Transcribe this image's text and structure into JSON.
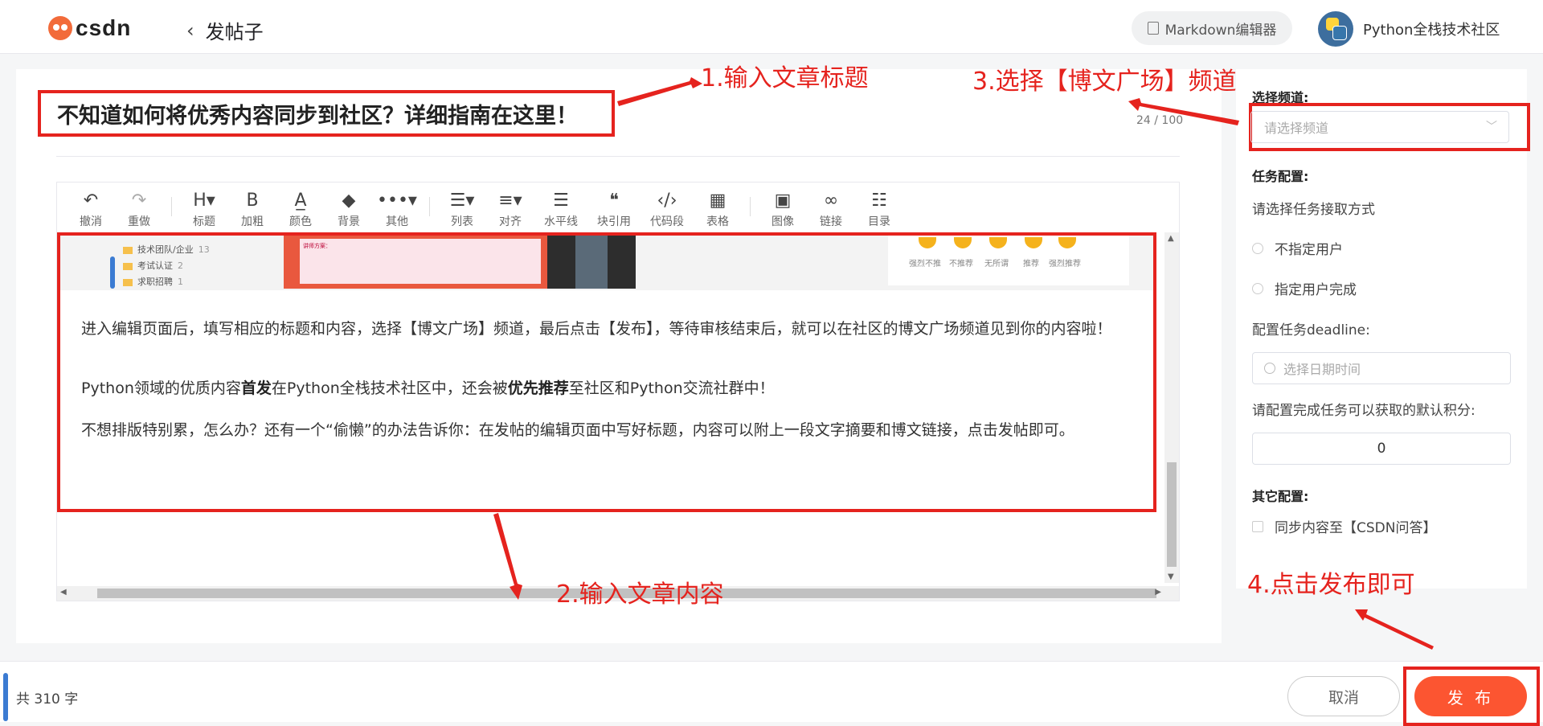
{
  "header": {
    "logo_text": "csdn",
    "back_label": "发帖子",
    "markdown_button": "Markdown编辑器",
    "community_name": "Python全栈技术社区"
  },
  "editor": {
    "title": "不知道如何将优秀内容同步到社区？详细指南在这里！",
    "title_counter": "24 / 100",
    "toolbar": [
      {
        "icon": "undo-icon",
        "glyph": "↶",
        "label": "撤消"
      },
      {
        "icon": "redo-icon",
        "glyph": "↷",
        "label": "重做"
      },
      {
        "icon": "heading-icon",
        "glyph": "H▾",
        "label": "标题"
      },
      {
        "icon": "bold-icon",
        "glyph": "B",
        "label": "加粗"
      },
      {
        "icon": "font-color-icon",
        "glyph": "A̲",
        "label": "颜色"
      },
      {
        "icon": "background-color-icon",
        "glyph": "◆",
        "label": "背景"
      },
      {
        "icon": "more-icon",
        "glyph": "•••▾",
        "label": "其他"
      },
      {
        "icon": "list-icon",
        "glyph": "☰▾",
        "label": "列表"
      },
      {
        "icon": "align-icon",
        "glyph": "≡▾",
        "label": "对齐"
      },
      {
        "icon": "horizontal-rule-icon",
        "glyph": "☰",
        "label": "水平线"
      },
      {
        "icon": "quote-icon",
        "glyph": "❝",
        "label": "块引用"
      },
      {
        "icon": "code-icon",
        "glyph": "‹/›",
        "label": "代码段"
      },
      {
        "icon": "table-icon",
        "glyph": "▦",
        "label": "表格"
      },
      {
        "icon": "image-icon",
        "glyph": "▣",
        "label": "图像"
      },
      {
        "icon": "link-icon",
        "glyph": "∞",
        "label": "链接"
      },
      {
        "icon": "toc-icon",
        "glyph": "☷",
        "label": "目录"
      }
    ],
    "tree_items": [
      {
        "label": "技术团队/企业",
        "count": "13"
      },
      {
        "label": "考试认证",
        "count": "2"
      },
      {
        "label": "求职招聘",
        "count": "1"
      }
    ],
    "poster_text": "讲师方案：",
    "emoji_labels": [
      "强烈不推",
      "不推荐",
      "无所谓",
      "推荐",
      "强烈推荐"
    ],
    "paragraph1": "进入编辑页面后，填写相应的标题和内容，选择【博文广场】频道，最后点击【发布】，等待审核结束后，就可以在社区的博文广场频道见到你的内容啦！",
    "paragraph2_a": "Python领域的优质内容",
    "paragraph2_b": "首发",
    "paragraph2_c": "在Python全栈技术社区中，还会被",
    "paragraph2_d": "优先推荐",
    "paragraph2_e": "至社区和Python交流社群中！",
    "paragraph3": "不想排版特别累，怎么办？还有一个“偷懒”的办法告诉你：在发帖的编辑页面中写好标题，内容可以附上一段文字摘要和博文链接，点击发帖即可。"
  },
  "sidebar": {
    "channel_label": "选择频道:",
    "channel_placeholder": "请选择频道",
    "task_label": "任务配置:",
    "task_prompt": "请选择任务接取方式",
    "radio_1": "不指定用户",
    "radio_2": "指定用户完成",
    "deadline_label": "配置任务deadline:",
    "deadline_placeholder": "选择日期时间",
    "points_label": "请配置完成任务可以获取的默认积分:",
    "points_value": "0",
    "other_label": "其它配置:",
    "sync_label": "同步内容至【CSDN问答】"
  },
  "footer": {
    "word_count": "共 310 字",
    "cancel": "取消",
    "publish": "发 布"
  },
  "annotations": {
    "step1": "1.输入文章标题",
    "step2": "2.输入文章内容",
    "step3": "3.选择【博文广场】频道",
    "step4": "4.点击发布即可"
  },
  "colors": {
    "annotation_red": "#e5231e",
    "publish_orange": "#fc5531"
  }
}
